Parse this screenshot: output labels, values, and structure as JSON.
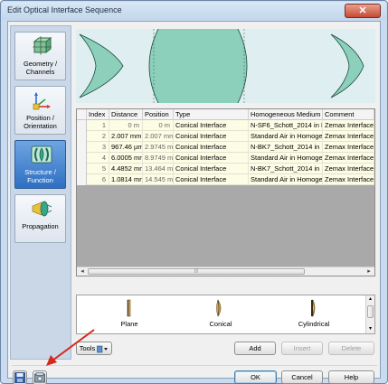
{
  "window": {
    "title": "Edit Optical Interface Sequence",
    "close_glyph": "✕"
  },
  "nav": [
    {
      "id": "geometry",
      "label": "Geometry / Channels",
      "icon": "geometry-cube-icon",
      "active": false
    },
    {
      "id": "position",
      "label": "Position / Orientation",
      "icon": "axes-icon",
      "active": false
    },
    {
      "id": "structure",
      "label": "Structure / Function",
      "icon": "lens-structure-icon",
      "active": true
    },
    {
      "id": "propagation",
      "label": "Propagation",
      "icon": "beam-propagation-icon",
      "active": false
    }
  ],
  "colors": {
    "lens_fill": "#8ccfba",
    "lens_dark": "#2a9a86",
    "row_bg": "#fdfce5",
    "empty_area": "#a9a9a9"
  },
  "table": {
    "columns": [
      "Index",
      "Distance",
      "Position",
      "Type",
      "Homogeneous Medium",
      "Comment"
    ],
    "rows": [
      [
        "1",
        "0 m",
        "0 m",
        "Conical Interface",
        "N-SF6_Schott_2014 in H",
        "Zemax Interface"
      ],
      [
        "2",
        "2.007 mm",
        "2.007 mm",
        "Conical Interface",
        "Standard Air in Homogen",
        "Zemax Interface"
      ],
      [
        "3",
        "967.46 µm",
        "2.9745 mr",
        "Conical Interface",
        "N-BK7_Schott_2014 in H",
        "Zemax Interface"
      ],
      [
        "4",
        "6.0005 mm",
        "8.9749 mr",
        "Conical Interface",
        "Standard Air in Homogen",
        "Zemax Interface"
      ],
      [
        "5",
        "4.4852 mm",
        "13.464 mr",
        "Conical Interface",
        "N-BK7_Schott_2014 in H",
        "Zemax Interface"
      ],
      [
        "6",
        "1.0814 mm",
        "14.545 mr",
        "Conical Interface",
        "Standard Air in Homogen",
        "Zemax Interface"
      ]
    ]
  },
  "palette": [
    {
      "label": "Plane",
      "icon": "plane-interface-icon"
    },
    {
      "label": "Conical",
      "icon": "conical-interface-icon"
    },
    {
      "label": "Cylindrical",
      "icon": "cylindrical-interface-icon"
    }
  ],
  "buttons": {
    "tools": "Tools",
    "add": "Add",
    "insert": "Insert",
    "delete": "Delete",
    "ok": "OK",
    "cancel": "Cancel",
    "help": "Help"
  },
  "scroll": {
    "left": "◂",
    "right": "▸",
    "up": "▴",
    "down": "▾",
    "grip": "|||"
  }
}
